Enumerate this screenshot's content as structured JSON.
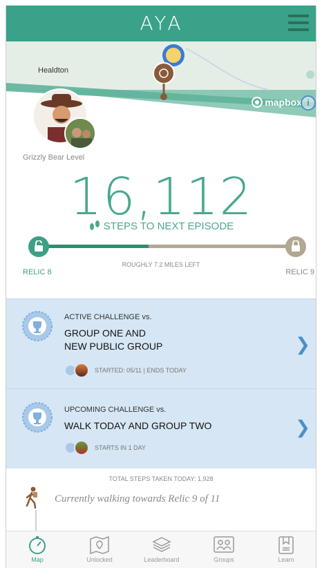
{
  "header": {
    "logo": "AYA"
  },
  "map": {
    "town_label": "Healdton",
    "attribution": "mapbox",
    "info": "i"
  },
  "profile": {
    "level": "Grizzly Bear Level"
  },
  "steps": {
    "count": "16,112",
    "label": "STEPS TO NEXT EPISODE"
  },
  "progress": {
    "from": "RELIC 8",
    "to": "RELIC 9",
    "remaining": "ROUGHLY 7.2 MILES LEFT",
    "fraction": 0.43
  },
  "challenges": [
    {
      "kicker": "ACTIVE CHALLENGE vs.",
      "title_line1": "GROUP ONE AND",
      "title_line2": "NEW PUBLIC GROUP",
      "meta": "STARTED: 05/11 | ENDS TODAY"
    },
    {
      "kicker": "UPCOMING CHALLENGE vs.",
      "title_line1": "WALK TODAY AND GROUP TWO",
      "meta": "STARTS IN 1 DAY"
    }
  ],
  "walking": {
    "total": "TOTAL STEPS TAKEN TODAY: 1,928",
    "status": "Currently walking towards Relic 9 of 11"
  },
  "tabs": [
    {
      "label": "Map",
      "icon": "compass-icon",
      "active": true
    },
    {
      "label": "Unlocked",
      "icon": "map-pin-icon",
      "active": false
    },
    {
      "label": "Leaderboard",
      "icon": "layers-icon",
      "active": false
    },
    {
      "label": "Groups",
      "icon": "people-icon",
      "active": false
    },
    {
      "label": "Learn",
      "icon": "bookmark-icon",
      "active": false
    }
  ],
  "colors": {
    "brand": "#3aa288",
    "challenge_bg": "#d6e6f5",
    "accent_blue": "#4a90c8"
  }
}
